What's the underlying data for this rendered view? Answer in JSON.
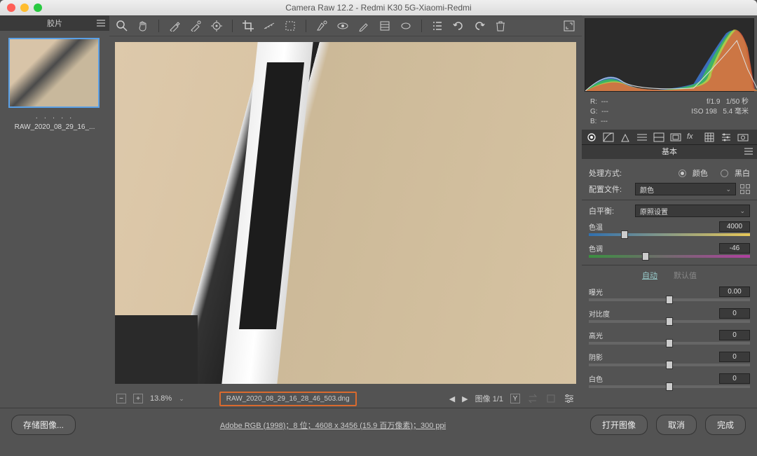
{
  "window": {
    "title": "Camera Raw 12.2  -  Redmi K30 5G-Xiaomi-Redmi"
  },
  "filmstrip": {
    "header": "胶片",
    "thumb_label": "RAW_2020_08_29_16_..."
  },
  "status": {
    "zoom": "13.8%",
    "filename": "RAW_2020_08_29_16_28_46_503.dng",
    "image_count": "图像 1/1",
    "y_btn": "Y"
  },
  "meta": {
    "r": "R:",
    "g": "G:",
    "b": "B:",
    "r_val": "---",
    "g_val": "---",
    "b_val": "---",
    "aperture": "f/1.9",
    "shutter": "1/50 秒",
    "iso": "ISO 198",
    "focal": "5.4 毫米"
  },
  "panel": {
    "title": "基本",
    "treatment_label": "处理方式:",
    "color_opt": "颜色",
    "bw_opt": "黑白",
    "profile_label": "配置文件:",
    "profile_value": "颜色",
    "wb_label": "白平衡:",
    "wb_value": "原照设置",
    "temp_label": "色温",
    "temp_value": "4000",
    "tint_label": "色调",
    "tint_value": "-46",
    "auto": "自动",
    "default": "默认值",
    "exposure_label": "曝光",
    "exposure_value": "0.00",
    "contrast_label": "对比度",
    "contrast_value": "0",
    "highlights_label": "高光",
    "highlights_value": "0",
    "shadows_label": "阴影",
    "shadows_value": "0",
    "whites_label": "白色",
    "whites_value": "0"
  },
  "footer": {
    "save": "存储图像...",
    "info": "Adobe RGB (1998)；8 位；4608 x 3456 (15.9 百万像素)；300 ppi",
    "open": "打开图像",
    "cancel": "取消",
    "done": "完成"
  }
}
